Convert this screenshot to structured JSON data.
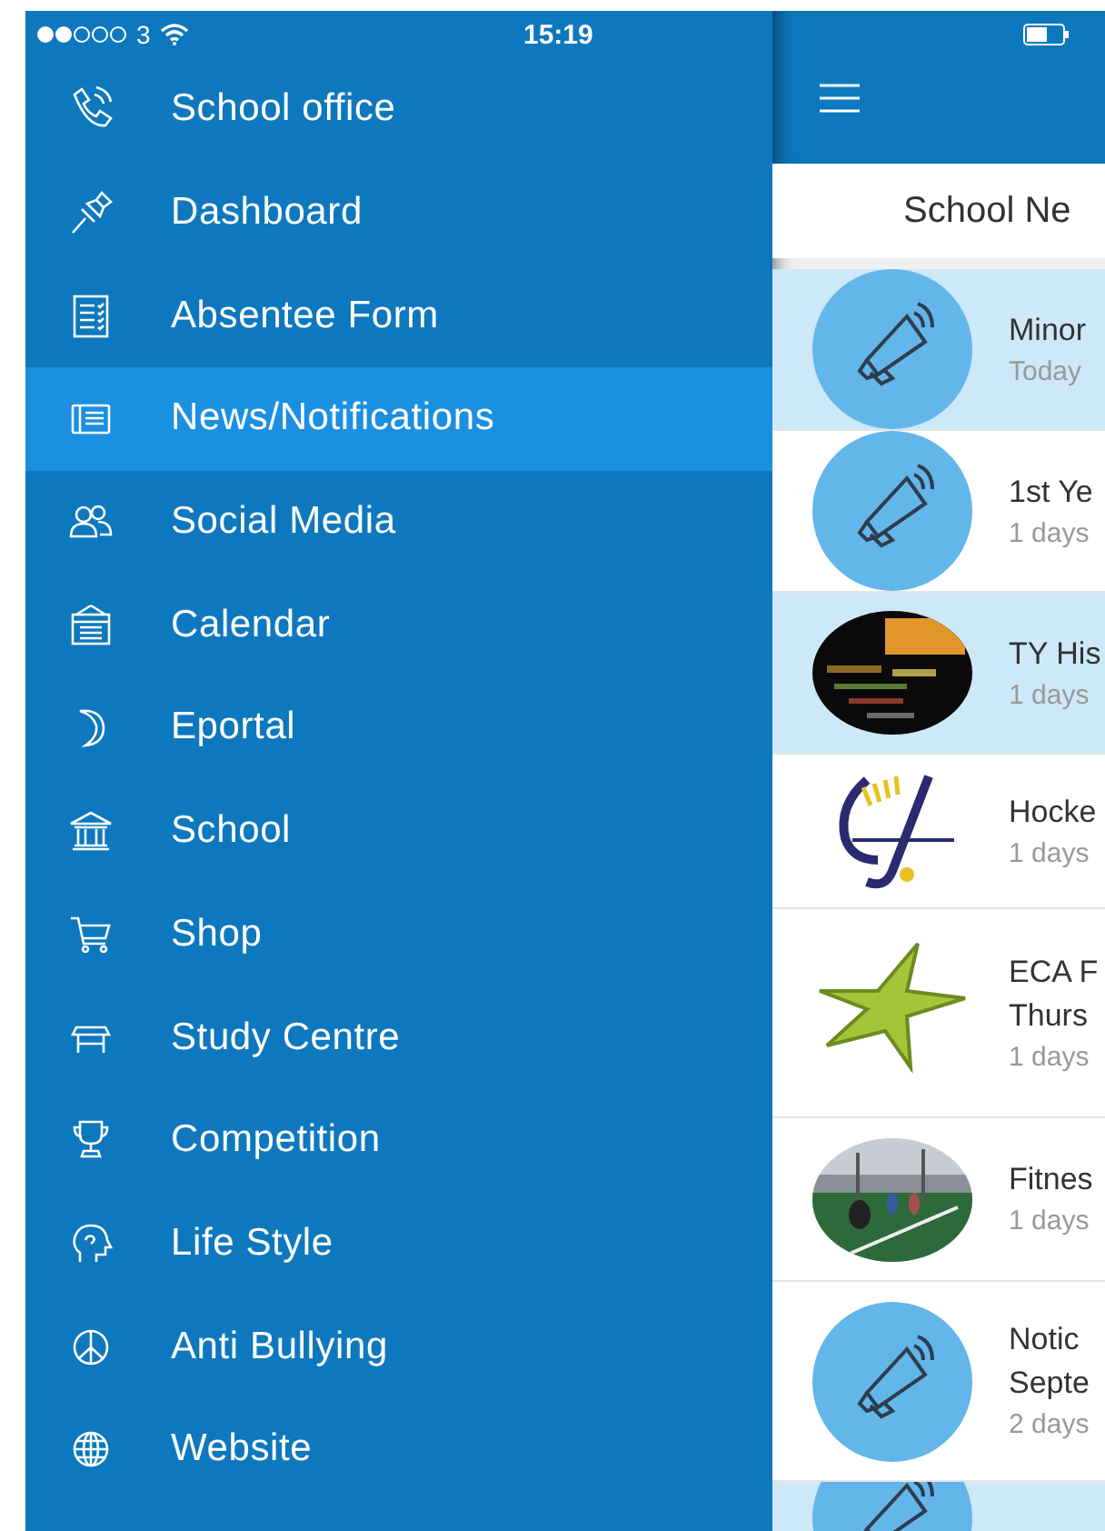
{
  "status_bar": {
    "carrier": "3",
    "time": "15:19"
  },
  "menu": [
    {
      "label": "School office",
      "kind": "phone",
      "selected": false
    },
    {
      "label": "Dashboard",
      "kind": "pin",
      "selected": false
    },
    {
      "label": "Absentee Form",
      "kind": "form",
      "selected": false
    },
    {
      "label": "News/Notifications",
      "kind": "news",
      "selected": true
    },
    {
      "label": "Social Media",
      "kind": "people",
      "selected": false
    },
    {
      "label": "Calendar",
      "kind": "calendar",
      "selected": false
    },
    {
      "label": "Eportal",
      "kind": "moon",
      "selected": false
    },
    {
      "label": "School",
      "kind": "bank",
      "selected": false
    },
    {
      "label": "Shop",
      "kind": "cart",
      "selected": false
    },
    {
      "label": "Study Centre",
      "kind": "desk",
      "selected": false
    },
    {
      "label": "Competition",
      "kind": "trophy",
      "selected": false
    },
    {
      "label": "Life Style",
      "kind": "head",
      "selected": false
    },
    {
      "label": "Anti Bullying",
      "kind": "peace",
      "selected": false
    },
    {
      "label": "Website",
      "kind": "globe",
      "selected": false
    }
  ],
  "panel": {
    "header": "School Ne"
  },
  "news": [
    {
      "lines": [
        "Minor"
      ],
      "date": "Today",
      "kind": "megaphone",
      "unread": true
    },
    {
      "lines": [
        "1st Ye"
      ],
      "date": "1 days",
      "kind": "megaphone",
      "unread": false
    },
    {
      "lines": [
        "TY His"
      ],
      "date": "1 days",
      "kind": "picture",
      "unread": true
    },
    {
      "lines": [
        "Hocke"
      ],
      "date": "1 days",
      "kind": "stick",
      "unread": false
    },
    {
      "lines": [
        "ECA F",
        "Thurs"
      ],
      "date": "1 days",
      "kind": "star",
      "unread": false
    },
    {
      "lines": [
        "Fitnes"
      ],
      "date": "1 days",
      "unread": false
    },
    {
      "lines": [
        "Notic",
        "Septe"
      ],
      "date": "2 days",
      "kind": "megaphone",
      "unread": false
    },
    {
      "kind": "megaphone",
      "unread": true
    }
  ]
}
